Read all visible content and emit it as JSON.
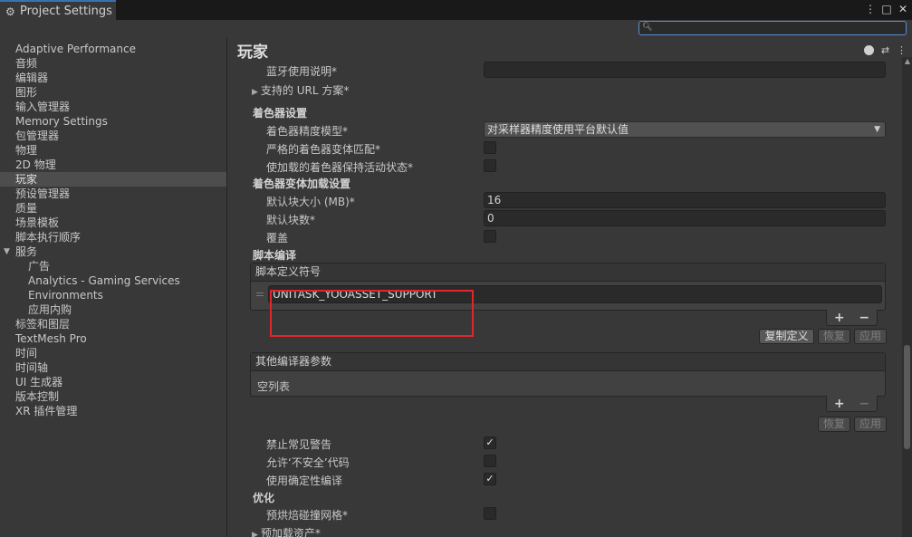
{
  "window": {
    "tab_title": "Project Settings",
    "controls": [
      "⋮",
      "□",
      "✕"
    ]
  },
  "search": {
    "placeholder": ""
  },
  "sidebar": {
    "items": [
      {
        "label": "Adaptive Performance"
      },
      {
        "label": "音频"
      },
      {
        "label": "编辑器"
      },
      {
        "label": "图形"
      },
      {
        "label": "输入管理器"
      },
      {
        "label": "Memory Settings"
      },
      {
        "label": "包管理器"
      },
      {
        "label": "物理"
      },
      {
        "label": "2D 物理"
      },
      {
        "label": "玩家",
        "selected": true
      },
      {
        "label": "预设管理器"
      },
      {
        "label": "质量"
      },
      {
        "label": "场景模板"
      },
      {
        "label": "脚本执行顺序"
      },
      {
        "label": "服务",
        "expanded": true
      },
      {
        "label": "广告",
        "child": true
      },
      {
        "label": "Analytics - Gaming Services",
        "child": true
      },
      {
        "label": "Environments",
        "child": true
      },
      {
        "label": "应用内购",
        "child": true
      },
      {
        "label": "标签和图层"
      },
      {
        "label": "TextMesh Pro"
      },
      {
        "label": "时间"
      },
      {
        "label": "时间轴"
      },
      {
        "label": "UI 生成器"
      },
      {
        "label": "版本控制"
      },
      {
        "label": "XR 插件管理"
      }
    ]
  },
  "main": {
    "title": "玩家",
    "bluetooth_label": "蓝牙使用说明*",
    "bluetooth_value": "",
    "url_schemes_label": "支持的 URL 方案*",
    "shader_settings": {
      "header": "着色器设置",
      "precision_label": "着色器精度模型*",
      "precision_value": "对采样器精度使用平台默认值",
      "strict_label": "严格的着色器变体匹配*",
      "strict_checked": false,
      "keep_loaded_label": "使加载的着色器保持活动状态*",
      "keep_loaded_checked": false
    },
    "shader_variant": {
      "header": "着色器变体加载设置",
      "chunk_size_label": "默认块大小 (MB)*",
      "chunk_size_value": "16",
      "chunk_count_label": "默认块数*",
      "chunk_count_value": "0",
      "override_label": "覆盖",
      "override_checked": false
    },
    "script_compile": {
      "header": "脚本编译",
      "define_symbols_header": "脚本定义符号",
      "define_symbols": [
        "UNITASK_YOOASSET_SUPPORT"
      ],
      "copy_defines": "复制定义",
      "revert": "恢复",
      "apply": "应用",
      "compiler_args_header": "其他编译器参数",
      "empty_list": "空列表",
      "revert2": "恢复",
      "apply2": "应用",
      "suppress_warnings_label": "禁止常见警告",
      "suppress_warnings_checked": true,
      "unsafe_code_label": "允许‘不安全’代码",
      "unsafe_code_checked": false,
      "deterministic_label": "使用确定性编译",
      "deterministic_checked": true
    },
    "optimization": {
      "header": "优化",
      "prebake_label": "预烘焙碰撞网格*",
      "prebake_checked": false,
      "preload_label": "预加载资产*"
    },
    "plus": "+",
    "minus": "−"
  }
}
